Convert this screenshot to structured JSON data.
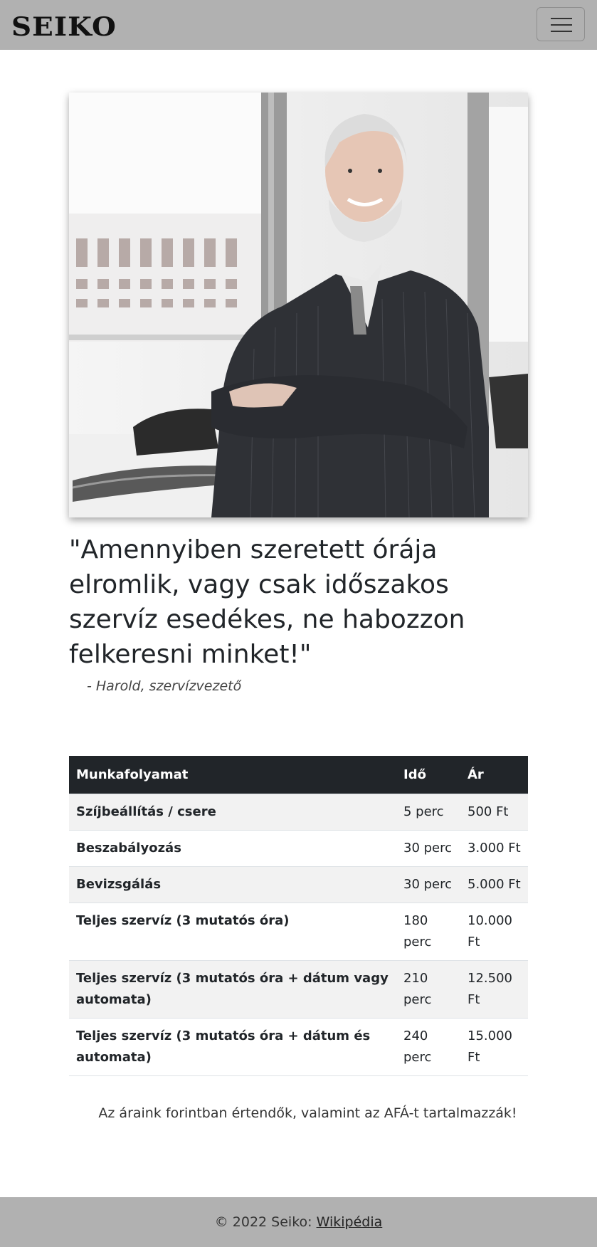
{
  "nav": {
    "brand": "SEIKO",
    "toggle_label": "Toggle navigation"
  },
  "hero": {
    "image_alt": "Harold, szervízvezető",
    "quote": "\"Amennyiben szeretett órája elromlik, vagy csak időszakos szervíz esedékes, ne habozzon felkeresni minket!\"",
    "attribution": "- Harold, szervízvezető"
  },
  "table": {
    "headers": [
      "Munkafolyamat",
      "Idő",
      "Ár"
    ],
    "rows": [
      {
        "task": "Szíjbeállítás / csere",
        "time": "5 perc",
        "price": "500 Ft"
      },
      {
        "task": "Beszabályozás",
        "time": "30 perc",
        "price": "3.000 Ft"
      },
      {
        "task": "Bevizsgálás",
        "time": "30 perc",
        "price": "5.000 Ft"
      },
      {
        "task": "Teljes szervíz (3 mutatós óra)",
        "time": "180 perc",
        "price": "10.000 Ft"
      },
      {
        "task": "Teljes szervíz (3 mutatós óra + dátum vagy automata)",
        "time": "210 perc",
        "price": "12.500 Ft"
      },
      {
        "task": "Teljes szervíz (3 mutatós óra + dátum és automata)",
        "time": "240 perc",
        "price": "15.000 Ft"
      }
    ]
  },
  "note": "Az áraink forintban értendők, valamint az AFÁ-t tartalmazzák!",
  "footer": {
    "copyright": "© 2022 Seiko: ",
    "link_label": "Wikipédia"
  },
  "colors": {
    "navbar_bg": "#b1b1b1",
    "table_header_bg": "#212529",
    "stripe_bg": "#f2f2f2"
  }
}
